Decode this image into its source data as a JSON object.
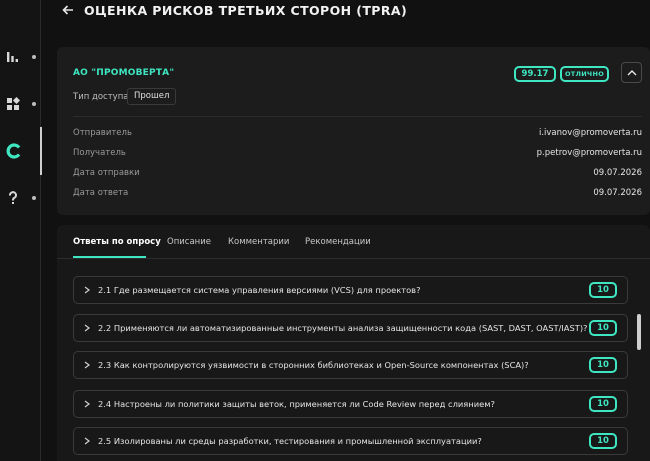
{
  "header": {
    "title": "ОЦЕНКА РИСКОВ ТРЕТЬИХ СТОРОН (TPRA)",
    "back_icon": "back-arrow-icon"
  },
  "sidebar": {
    "items": [
      {
        "name": "analytics",
        "icon": "bar-chart-icon"
      },
      {
        "name": "modules",
        "icon": "grid-icon"
      },
      {
        "name": "brand",
        "icon": "c-logo-icon",
        "active": true
      },
      {
        "name": "help",
        "icon": "question-icon"
      }
    ]
  },
  "card": {
    "company": "АО \"ПРОМОВЕРТА\"",
    "access_label": "Тип доступа",
    "access_value": "Прошел",
    "score": "99.17",
    "status": "ОТЛИЧНО",
    "rows": [
      {
        "label": "Отправитель",
        "value": "i.ivanov@promoverta.ru"
      },
      {
        "label": "Получатель",
        "value": "p.petrov@promoverta.ru"
      },
      {
        "label": "Дата отправки",
        "value": "09.07.2026"
      },
      {
        "label": "Дата ответа",
        "value": "09.07.2026"
      }
    ]
  },
  "tabs": [
    "Ответы по опросу",
    "Описание",
    "Комментарии",
    "Рекомендации"
  ],
  "questions": [
    {
      "text": "2.1 Где размещается система управления версиями (VCS) для проектов?",
      "score": "10"
    },
    {
      "text": "2.2 Применяются ли автоматизированные инструменты анализа защищенности кода (SAST, DAST, OAST/IAST)?",
      "score": "10"
    },
    {
      "text": "2.3 Как контролируются уязвимости в сторонних библиотеках и Open-Source компонентах (SCA)?",
      "score": "10"
    },
    {
      "text": "2.4 Настроены ли политики защиты веток, применяется ли Code Review перед слиянием?",
      "score": "10"
    },
    {
      "text": "2.5 Изолированы ли среды разработки, тестирования и промышленной эксплуатации?",
      "score": "10"
    }
  ],
  "colors": {
    "accent": "#3ee6c1",
    "background": "#111111",
    "card": "#1c1c1c"
  }
}
